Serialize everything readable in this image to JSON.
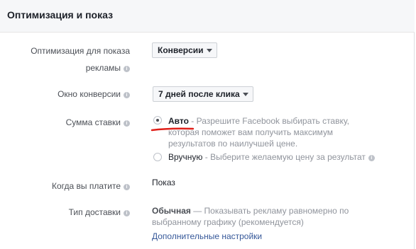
{
  "section": {
    "title": "Оптимизация и показ"
  },
  "optimization": {
    "label": "Оптимизация для показа рекламы",
    "label_line1": "Оптимизация для показа",
    "label_line2": "рекламы",
    "value": "Конверсии"
  },
  "conversion_window": {
    "label": "Окно конверсии",
    "value": "7 дней после клика"
  },
  "bid_amount": {
    "label": "Сумма ставки",
    "options": [
      {
        "title": "Авто",
        "description": " - Разрешите Facebook выбирать ставку, которая поможет вам получить максимум результатов по наилучшей цене.",
        "selected": true
      },
      {
        "title": "Вручную",
        "description": " - Выберите желаемую цену за результат",
        "selected": false
      }
    ]
  },
  "billing": {
    "label": "Когда вы платите",
    "value": "Показ"
  },
  "delivery": {
    "label": "Тип доставки",
    "value_title": "Обычная",
    "value_description": " — Показывать рекламу равномерно по выбранному графику (рекомендуется)",
    "more_settings_link": "Дополнительные настройки"
  },
  "colors": {
    "header_bg": "#f6f7f9",
    "link": "#365899",
    "annotation_underline": "#e0201a"
  },
  "icons": {
    "info": "info-icon",
    "dropdown": "chevron-down-icon"
  }
}
